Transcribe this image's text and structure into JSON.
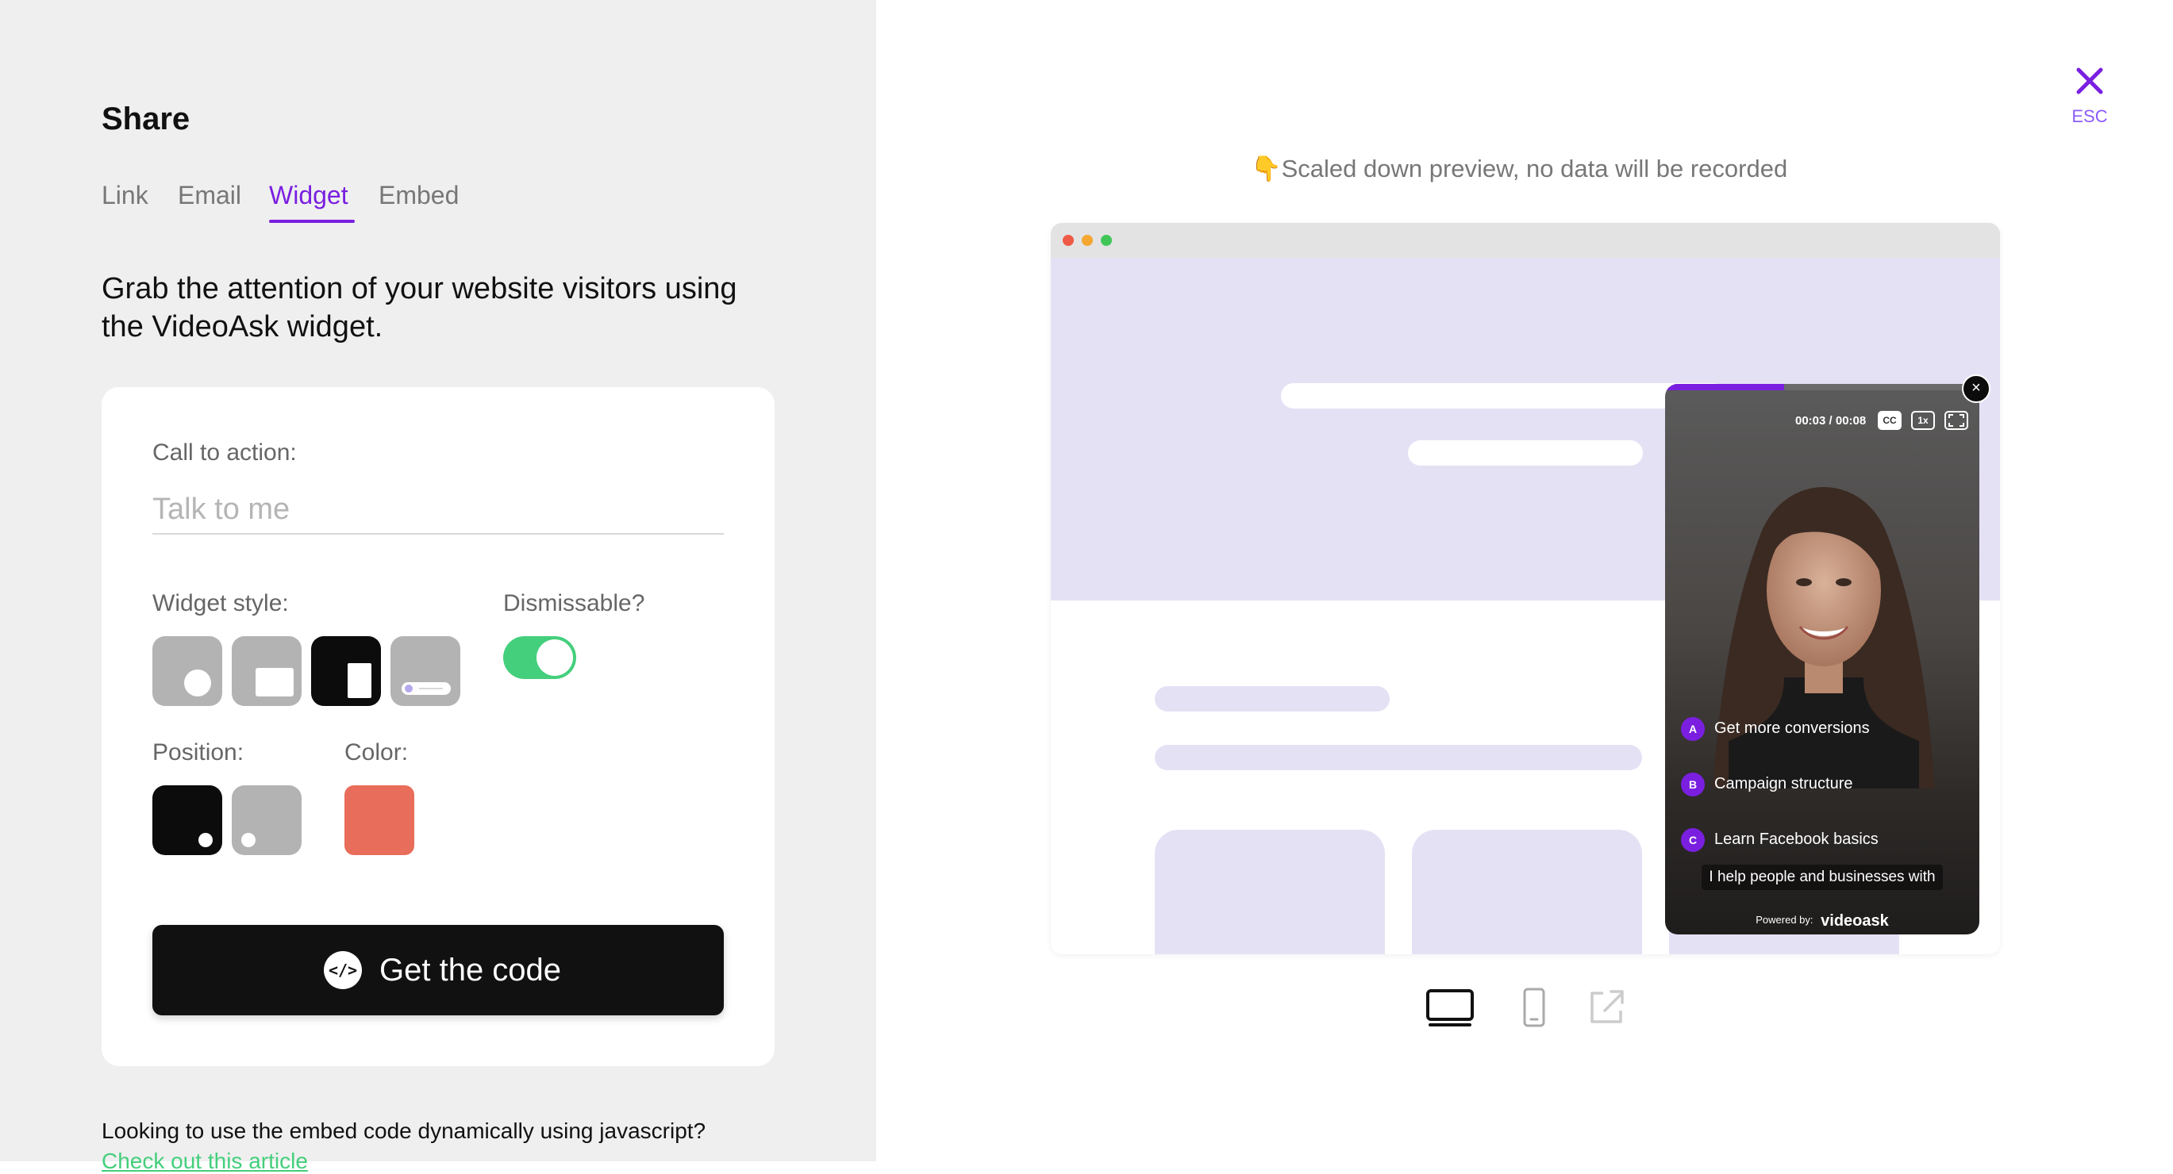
{
  "share": {
    "title": "Share",
    "tabs": [
      {
        "label": "Link"
      },
      {
        "label": "Email"
      },
      {
        "label": "Widget",
        "active": true
      },
      {
        "label": "Embed"
      }
    ],
    "headline": "Grab the attention of your website visitors using the VideoAsk widget."
  },
  "form": {
    "cta_label": "Call to action:",
    "cta_placeholder": "Talk to me",
    "cta_value": "",
    "widget_style_label": "Widget style:",
    "widget_styles": [
      "circle-style-icon",
      "rectangle-style-icon",
      "tall-rectangle-style-icon",
      "pill-style-icon"
    ],
    "selected_style_index": 2,
    "dismissable_label": "Dismissable?",
    "dismissable": true,
    "position_label": "Position:",
    "positions": [
      "bottom-right",
      "bottom-left"
    ],
    "selected_position": "bottom-right",
    "color_label": "Color:",
    "color": "#e86d5a",
    "get_code_label": "Get the code",
    "get_code_icon": "code-icon"
  },
  "footer": {
    "question": "Looking to use the embed code dynamically using javascript?",
    "link": "Check out this article"
  },
  "preview": {
    "close_label": "ESC",
    "note": "👇Scaled down preview, no data will be recorded",
    "widget": {
      "progress": 0.38,
      "time": "00:03 / 00:08",
      "cc_label": "CC",
      "speed_label": "1x",
      "answers": [
        {
          "letter": "A",
          "text": "Get more conversions"
        },
        {
          "letter": "B",
          "text": "Campaign structure"
        },
        {
          "letter": "C",
          "text": "Learn Facebook basics"
        }
      ],
      "caption": "I help people and businesses with",
      "powered_by": "Powered by:",
      "brand": "videoask"
    },
    "devices": [
      "desktop-icon",
      "mobile-icon",
      "open-external-icon"
    ],
    "selected_device": "desktop-icon"
  },
  "colors": {
    "accent": "#7a1fe0",
    "toggle_on": "#44cf7c",
    "preview_placeholder": "#e5e1f5"
  }
}
